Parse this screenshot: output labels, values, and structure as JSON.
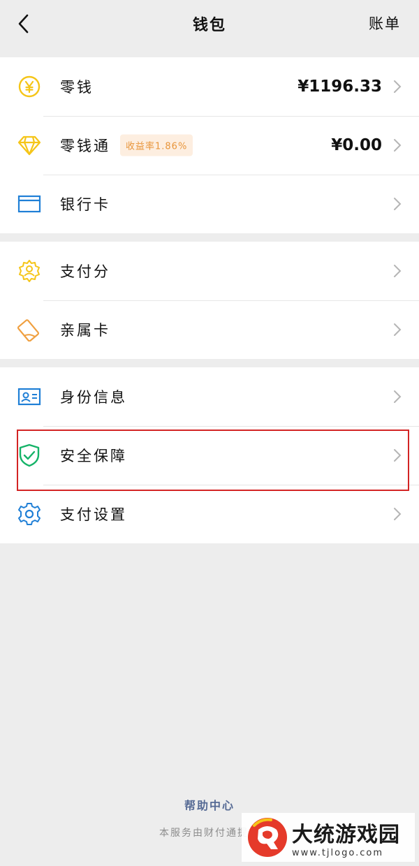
{
  "header": {
    "title": "钱包",
    "right_label": "账单"
  },
  "groups": [
    {
      "items": [
        {
          "label": "零钱",
          "value": "¥1196.33",
          "icon": "yen-coin-icon"
        },
        {
          "label": "零钱通",
          "badge": "收益率1.86%",
          "value": "¥0.00",
          "icon": "diamond-icon"
        },
        {
          "label": "银行卡",
          "icon": "bank-card-icon"
        }
      ]
    },
    {
      "items": [
        {
          "label": "支付分",
          "icon": "pay-score-icon"
        },
        {
          "label": "亲属卡",
          "icon": "family-card-icon"
        }
      ]
    },
    {
      "items": [
        {
          "label": "身份信息",
          "icon": "id-card-icon"
        },
        {
          "label": "安全保障",
          "icon": "shield-check-icon"
        },
        {
          "label": "支付设置",
          "icon": "gear-icon"
        }
      ]
    }
  ],
  "footer": {
    "help_link": "帮助中心",
    "note": "本服务由财付通提供"
  },
  "watermark": {
    "title": "大统游戏园",
    "url": "www.tjlogo.com"
  },
  "colors": {
    "accent_yellow": "#f5c518",
    "accent_blue": "#1f7fd6",
    "accent_green": "#15b368",
    "accent_orange": "#f0a040",
    "highlight": "#d32424",
    "link": "#576b95"
  }
}
